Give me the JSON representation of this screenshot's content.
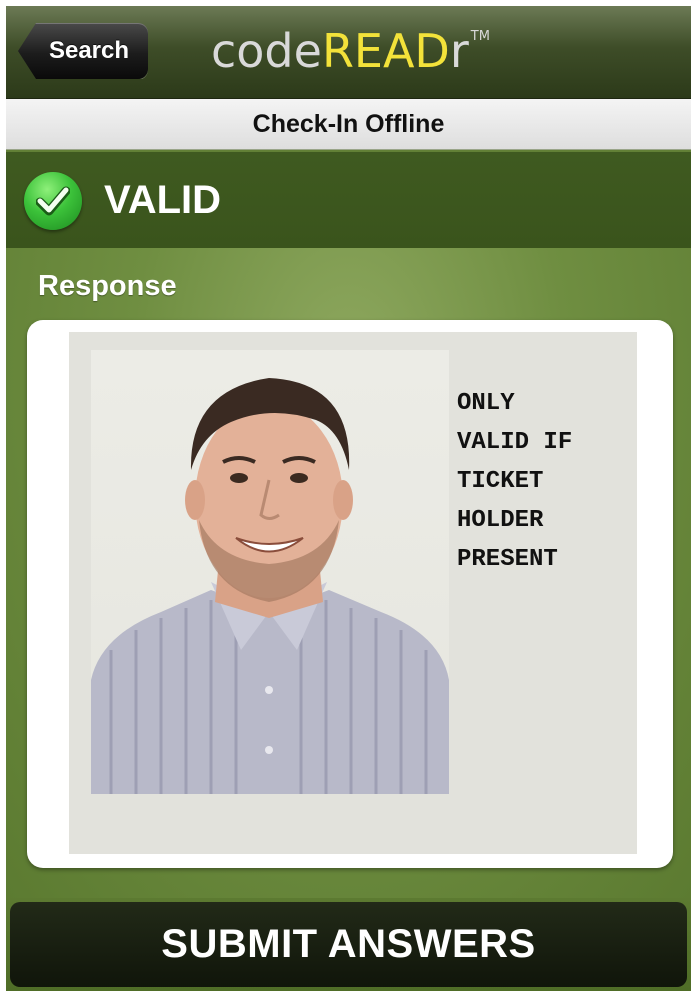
{
  "navbar": {
    "back_label": "Search",
    "logo": {
      "part1": "code",
      "part2": "READ",
      "part3": "r",
      "trademark": "TM"
    }
  },
  "subtitle": "Check-In Offline",
  "status": {
    "icon": "check-circle-icon",
    "text": "VALID",
    "color": "#3cc23a"
  },
  "response": {
    "label": "Response",
    "note_lines": "ONLY\nVALID IF\nTICKET\nHOLDER\nPRESENT"
  },
  "submit": {
    "label": "SUBMIT ANSWERS"
  },
  "colors": {
    "logo_accent": "#f3e23a",
    "background_green": "#6b8a3c"
  }
}
